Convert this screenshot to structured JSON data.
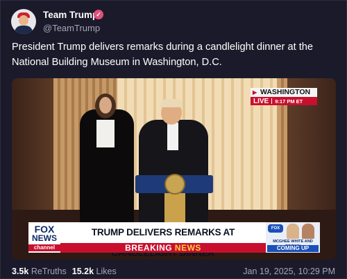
{
  "header": {
    "name": "Team Trump",
    "handle": "@TeamTrump",
    "verified_color": "#e0507a"
  },
  "post": {
    "text": "President Trump delivers remarks during a candlelight dinner at the National Building Museum in Washington, D.C."
  },
  "video": {
    "bug": {
      "location": "WASHINGTON",
      "live": "LIVE",
      "time": "9:17 PM ET"
    },
    "lower_third": {
      "network_line1": "FOX",
      "network_line2": "NEWS",
      "network_line3": "channel",
      "headline": "TRUMP DELIVERS REMARKS AT CANDLELIGHT DINNER",
      "breaking_part1": "BREAKING",
      "breaking_part2": "NEWS",
      "promo_logo": "FOX",
      "promo_names": "MCGHEE WHITE AND BROWN",
      "promo_coming": "COMING UP"
    }
  },
  "footer": {
    "retruths_count": "3.5k",
    "retruths_label": "ReTruths",
    "likes_count": "15.2k",
    "likes_label": "Likes",
    "timestamp": "Jan 19, 2025, 10:29 PM"
  },
  "colors": {
    "background": "#1b1a2b",
    "muted_text": "#a6a6b8",
    "fox_red": "#c8102e",
    "fox_blue": "#0b2a66"
  }
}
